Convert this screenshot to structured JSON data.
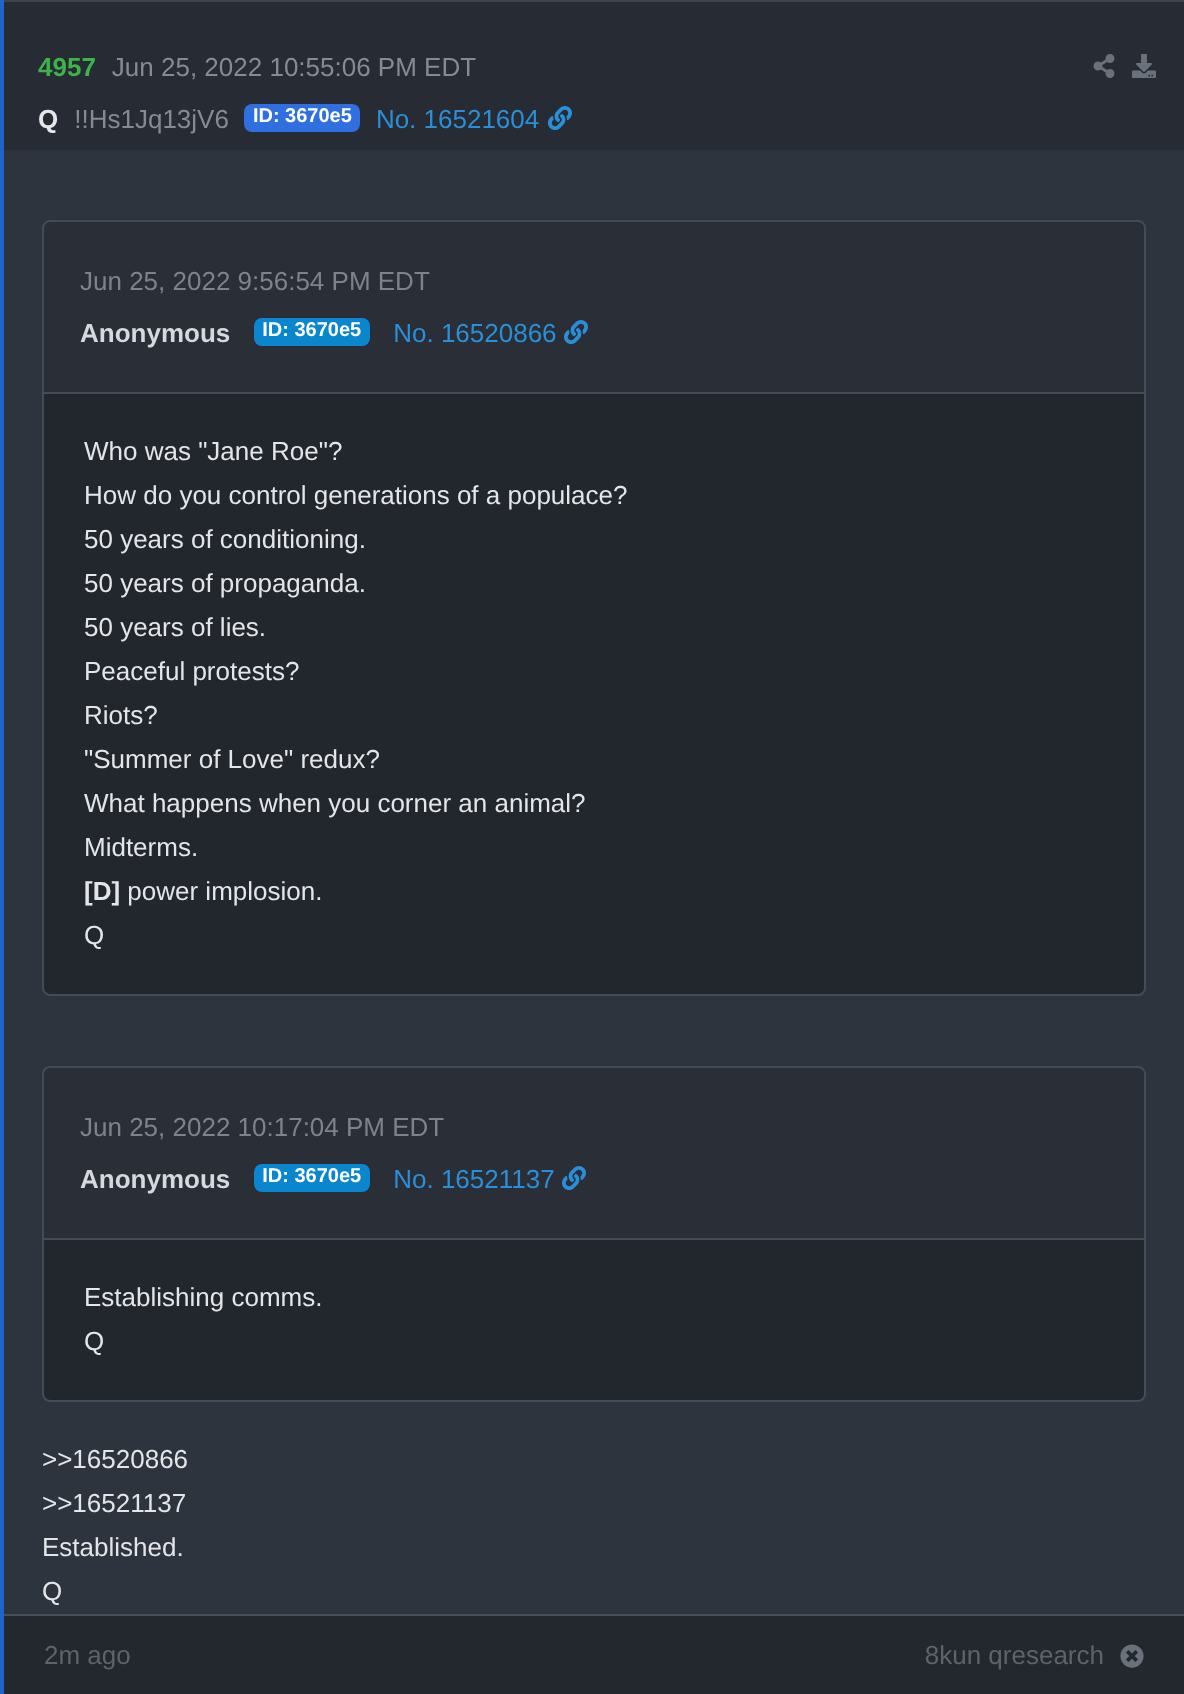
{
  "post": {
    "number": "4957",
    "timestamp": "Jun 25, 2022 10:55:06 PM EDT",
    "author": "Q",
    "tripcode": "!!Hs1Jq13jV6",
    "id_badge": {
      "label": "ID: 3670e5",
      "color": "#2f6fe0"
    },
    "post_no": "No. 16521604"
  },
  "quotes": [
    {
      "timestamp": "Jun 25, 2022 9:56:54 PM EDT",
      "author": "Anonymous",
      "id_badge": {
        "label": "ID: 3670e5",
        "color": "#0a86cf"
      },
      "post_no": "No. 16520866",
      "lines": [
        "Who was \"Jane Roe\"?",
        "How do you control generations of a populace?",
        "50 years of conditioning.",
        "50 years of propaganda.",
        "50 years of lies.",
        "Peaceful protests?",
        "Riots?",
        "\"Summer of Love\" redux?",
        "What happens when you corner an animal?",
        "Midterms.",
        "**[D]** power implosion.",
        "Q"
      ]
    },
    {
      "timestamp": "Jun 25, 2022 10:17:04 PM EDT",
      "author": "Anonymous",
      "id_badge": {
        "label": "ID: 3670e5",
        "color": "#0a86cf"
      },
      "post_no": "No. 16521137",
      "lines": [
        "Establishing comms.",
        "Q"
      ]
    }
  ],
  "body_lines": [
    ">>16520866",
    ">>16521137",
    "Established.",
    "Q"
  ],
  "footer": {
    "age": "2m ago",
    "source": "8kun qresearch"
  }
}
